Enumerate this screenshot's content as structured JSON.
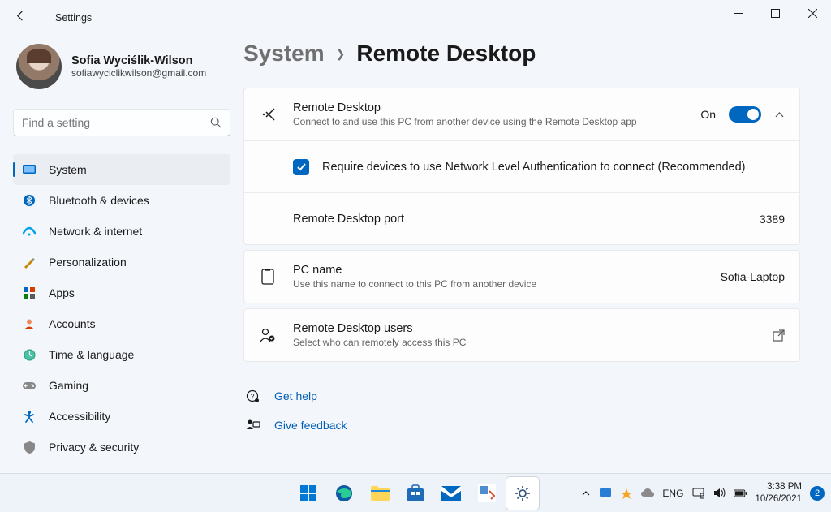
{
  "window": {
    "title": "Settings"
  },
  "user": {
    "name": "Sofia Wyciślik-Wilson",
    "email": "sofiawyciclikwilson@gmail.com"
  },
  "search": {
    "placeholder": "Find a setting"
  },
  "nav": {
    "system": "System",
    "bluetooth": "Bluetooth & devices",
    "network": "Network & internet",
    "personalization": "Personalization",
    "apps": "Apps",
    "accounts": "Accounts",
    "time": "Time & language",
    "gaming": "Gaming",
    "accessibility": "Accessibility",
    "privacy": "Privacy & security"
  },
  "breadcrumb": {
    "seg1": "System",
    "seg2": "Remote Desktop"
  },
  "rd": {
    "title": "Remote Desktop",
    "sub": "Connect to and use this PC from another device using the Remote Desktop app",
    "state": "On",
    "nla": "Require devices to use Network Level Authentication to connect (Recommended)",
    "port_label": "Remote Desktop port",
    "port_value": "3389"
  },
  "pc": {
    "title": "PC name",
    "sub": "Use this name to connect to this PC from another device",
    "value": "Sofia-Laptop"
  },
  "users": {
    "title": "Remote Desktop users",
    "sub": "Select who can remotely access this PC"
  },
  "links": {
    "help": "Get help",
    "feedback": "Give feedback"
  },
  "taskbar": {
    "lang": "ENG",
    "time": "3:38 PM",
    "date": "10/26/2021",
    "badge": "2"
  }
}
